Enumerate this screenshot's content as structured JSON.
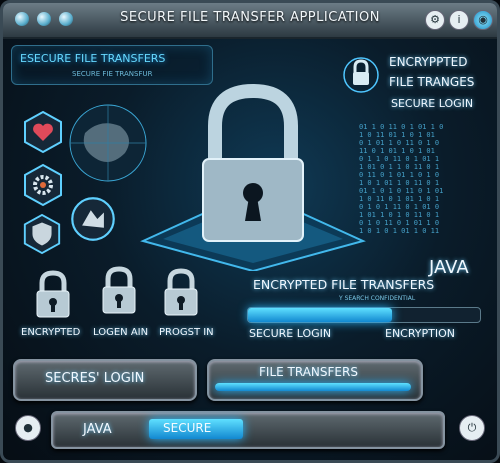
{
  "window": {
    "title": "SECURE FILE TRANSFER APPLICATION",
    "controls": [
      "gear-icon",
      "info-icon",
      "close-icon"
    ]
  },
  "header_panel": {
    "title": "ESECURE FILE TRANSFERS",
    "subtitle": "SECURE FIE TRANSFUR"
  },
  "right_panel": {
    "line1": "ENCRYPPTED",
    "line2": "FILE TRANGES",
    "line3": "SECURE LOGIN"
  },
  "center": {
    "java": "JAVA",
    "encrypted": "ENCRYPTED FILE TRANSFERS",
    "subtext": "Y SEARCH CONFIDENTIAL"
  },
  "locks": [
    {
      "label": "ENCRYPTED"
    },
    {
      "label": "LOGEN AIN"
    },
    {
      "label": "PROGST IN"
    }
  ],
  "secure_login_bar": {
    "label": "SECURE LOGIN",
    "progress": 0.62
  },
  "encryption_label": "ENCRYPTION",
  "buttons": {
    "secures_login": "SECRES' LOGIN",
    "file_transfers": "FILE TRANSFERS"
  },
  "bottom": {
    "java_label": "JAVA",
    "secure_label": "SECURE"
  },
  "colors": {
    "accent": "#2fb8ff",
    "frame": "#3a4a55",
    "text": "#dff6ff"
  }
}
